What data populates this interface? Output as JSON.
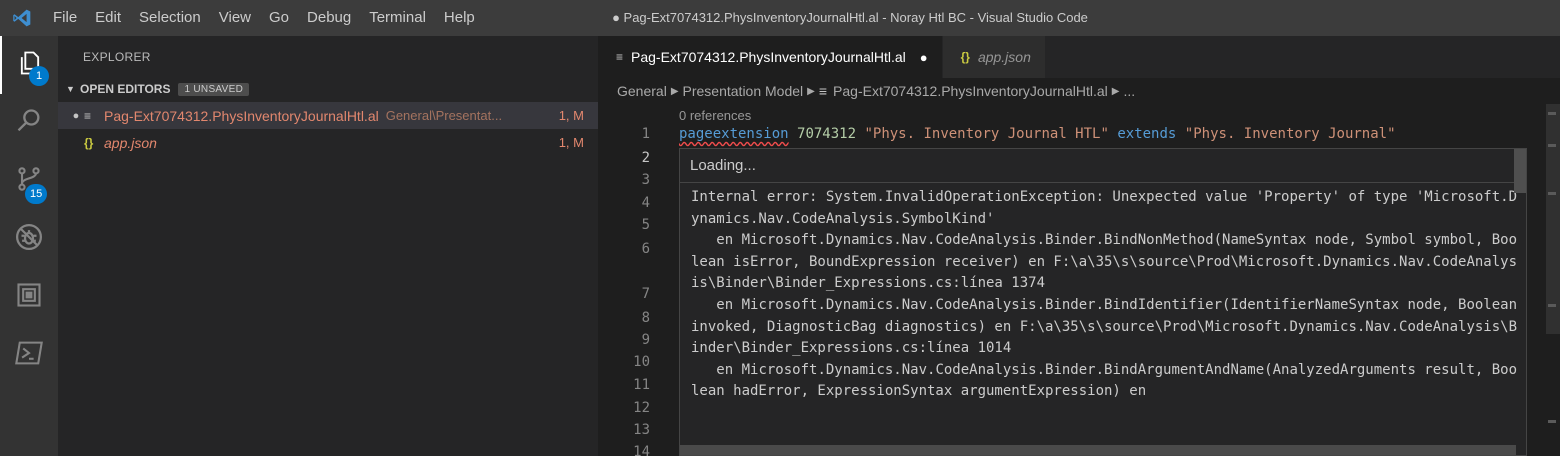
{
  "titlebar": {
    "menu": [
      "File",
      "Edit",
      "Selection",
      "View",
      "Go",
      "Debug",
      "Terminal",
      "Help"
    ],
    "window_title": "● Pag-Ext7074312.PhysInventoryJournalHtl.al - Noray Htl BC - Visual Studio Code"
  },
  "activity": {
    "explorer_badge": "1",
    "scm_badge": "15"
  },
  "sidebar": {
    "title": "EXPLORER",
    "open_editors_label": "OPEN EDITORS",
    "unsaved_badge": "1 UNSAVED",
    "files": [
      {
        "name": "Pag-Ext7074312.PhysInventoryJournalHtl.al",
        "path": "General\\Presentat...",
        "status": "1, M",
        "dot": "●",
        "icon": "≡"
      },
      {
        "name": "app.json",
        "path": "",
        "status": "1, M",
        "dot": "",
        "icon": "{}"
      }
    ]
  },
  "editor": {
    "tabs": [
      {
        "label": "Pag-Ext7074312.PhysInventoryJournalHtl.al",
        "icon": "≡",
        "dirty": "●"
      },
      {
        "label": "app.json",
        "icon": "{}"
      }
    ],
    "breadcrumbs": [
      "General",
      "Presentation Model",
      "Pag-Ext7074312.PhysInventoryJournalHtl.al",
      "..."
    ],
    "codelens": "0 references",
    "line_numbers": [
      "1",
      "2",
      "3",
      "4",
      "5",
      "6",
      "7",
      "8",
      "9",
      "10",
      "11",
      "12",
      "13",
      "14"
    ],
    "line1": {
      "kw1": "pageextension",
      "num": "7074312",
      "str1": "\"Phys. Inventory Journal HTL\"",
      "kw2": "extends",
      "str2": "\"Phys. Inventory Journal\""
    },
    "hover": {
      "loading": "Loading...",
      "message": "Internal error: System.InvalidOperationException: Unexpected value 'Property' of type 'Microsoft.Dynamics.Nav.CodeAnalysis.SymbolKind'\n   en Microsoft.Dynamics.Nav.CodeAnalysis.Binder.BindNonMethod(NameSyntax node, Symbol symbol, Boolean isError, BoundExpression receiver) en F:\\a\\35\\s\\source\\Prod\\Microsoft.Dynamics.Nav.CodeAnalysis\\Binder\\Binder_Expressions.cs:línea 1374\n   en Microsoft.Dynamics.Nav.CodeAnalysis.Binder.BindIdentifier(IdentifierNameSyntax node, Boolean invoked, DiagnosticBag diagnostics) en F:\\a\\35\\s\\source\\Prod\\Microsoft.Dynamics.Nav.CodeAnalysis\\Binder\\Binder_Expressions.cs:línea 1014\n   en Microsoft.Dynamics.Nav.CodeAnalysis.Binder.BindArgumentAndName(AnalyzedArguments result, Boolean hadError, ExpressionSyntax argumentExpression) en"
    }
  },
  "colors": {
    "accent": "#007acc",
    "modified": "#e2876e",
    "json_icon": "#cbcb41"
  },
  "icons": {
    "logo": "vscode-logo-icon",
    "explorer": "files-icon",
    "search": "search-icon",
    "scm": "source-control-icon",
    "debug": "debug-icon",
    "extensions": "extensions-icon",
    "terminal": "terminal-icon"
  }
}
